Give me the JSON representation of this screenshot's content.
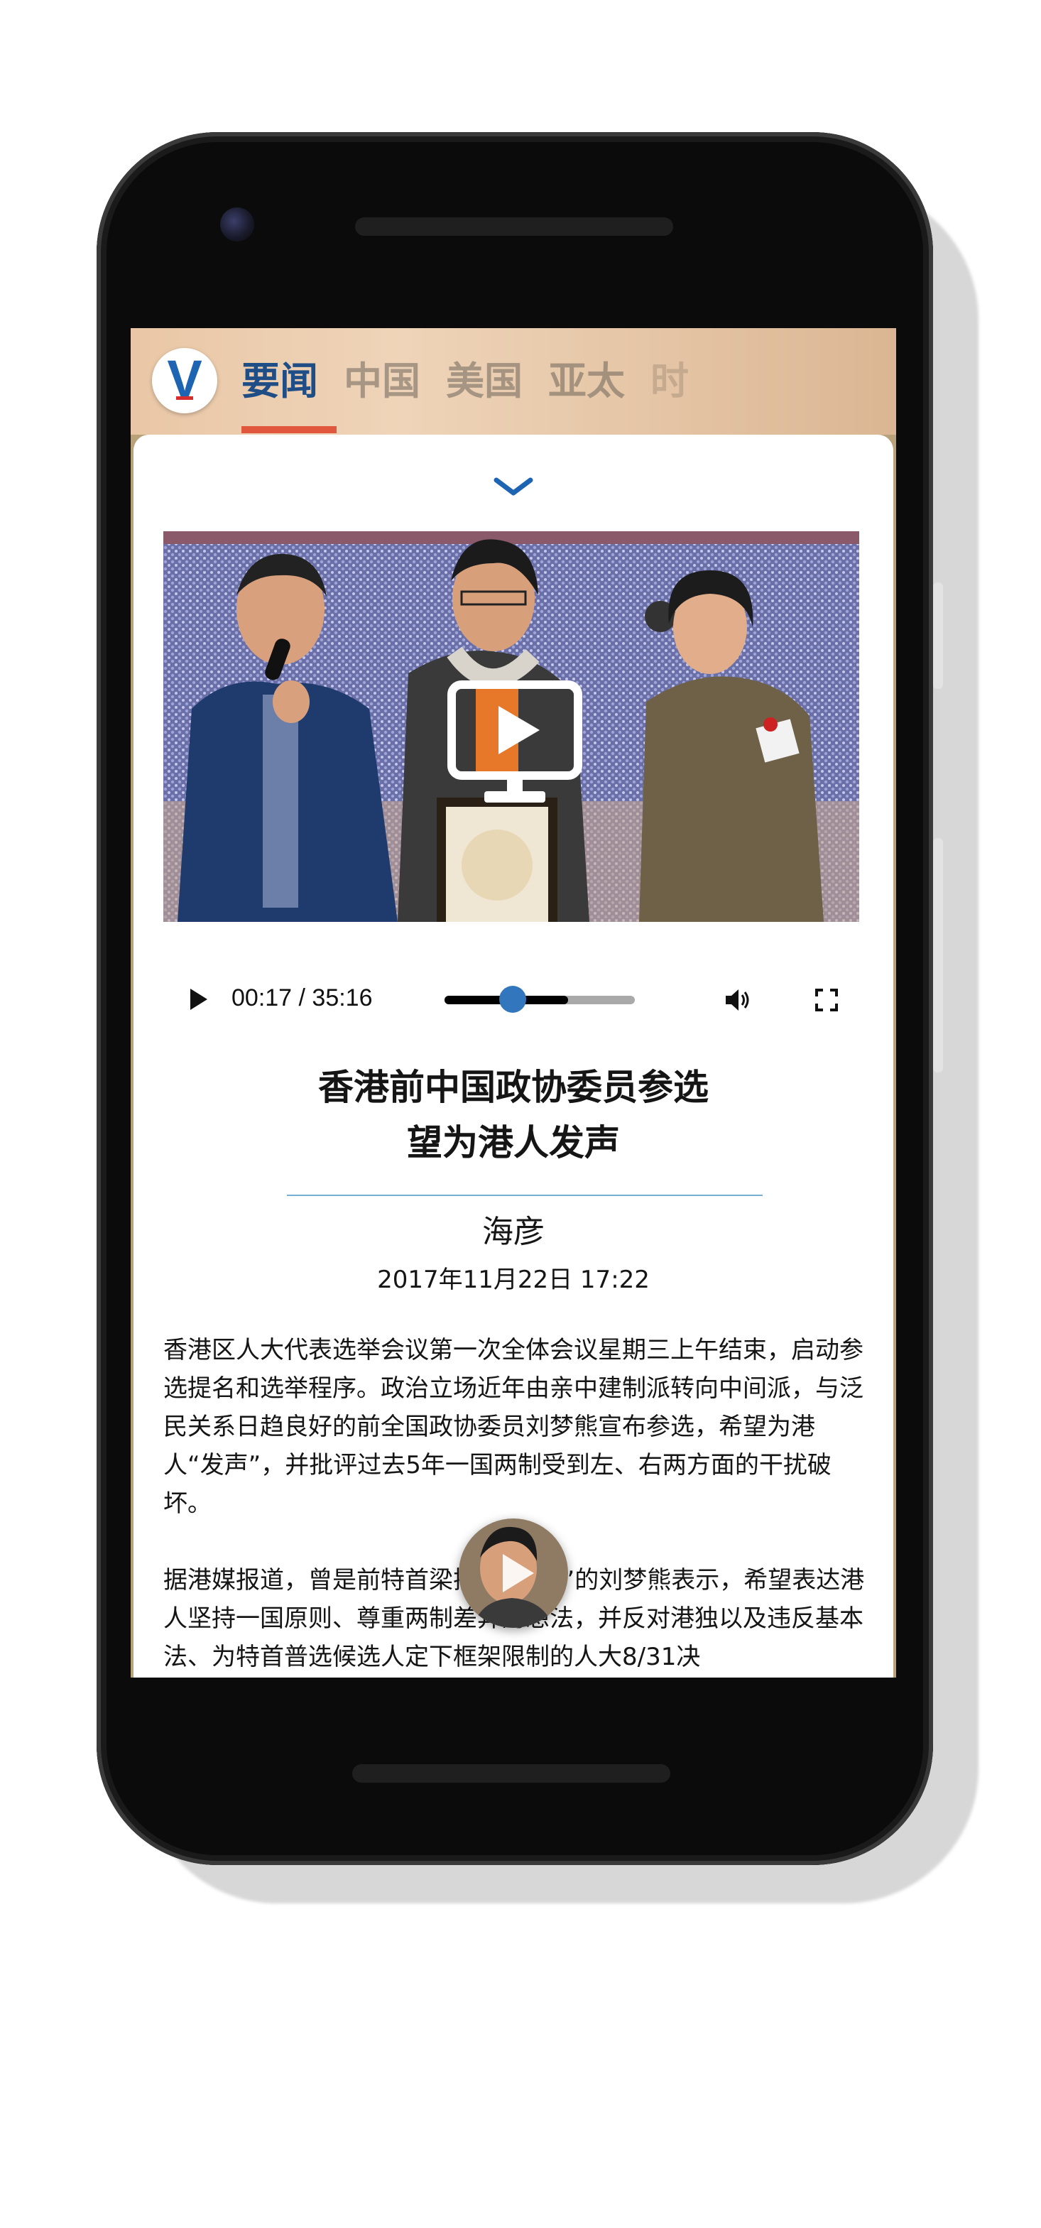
{
  "app": {
    "logo_letter": "V",
    "tabs": [
      {
        "label": "要闻",
        "active": true
      },
      {
        "label": "中国",
        "active": false
      },
      {
        "label": "美国",
        "active": false
      },
      {
        "label": "亚太",
        "active": false
      },
      {
        "label": "时",
        "active": false
      }
    ]
  },
  "player": {
    "time": "00:17 / 35:16",
    "progress": 0.65,
    "buffered": 0.65,
    "position": 0.36
  },
  "article": {
    "title_line1": "香港前中国政协委员参选",
    "title_line2": "望为港人发声",
    "author": "海彦",
    "date": "2017年11月22日 17:22",
    "paragraph1": "香港区人大代表选举会议第一次全体会议星期三上午结束，启动参选提名和选举程序。政治立场近年由亲中建制派转向中间派，与泛民关系日趋良好的前全国政协委员刘梦熊宣布参选，希望为港人“发声”，并批评过去5年一国两制受到左、右两方面的干扰破坏。",
    "paragraph2": "据港媒报道，曾是前特首梁振英“梁粉”的刘梦熊表示，希望表达港人坚持一国原则、尊重两制差异的想法，并反对港独以及违反基本法、为特首普选候选人定下框架限制的人大8/31决"
  },
  "colors": {
    "accent": "#1f4e86",
    "tab_underline": "#e0573e",
    "progress_knob": "#3277bd",
    "divider": "#77b0d4"
  },
  "icons": {
    "collapse": "chevron-down-icon",
    "video_play": "monitor-play-icon",
    "control_play": "play-icon",
    "volume": "volume-icon",
    "fullscreen": "fullscreen-icon"
  }
}
